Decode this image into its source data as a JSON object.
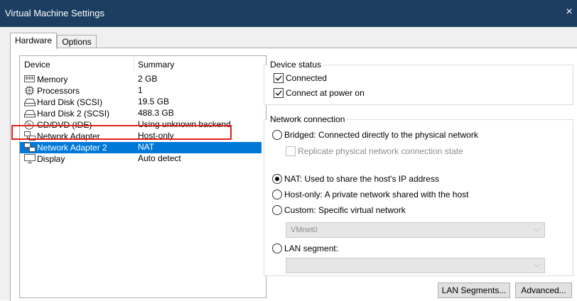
{
  "window": {
    "title": "Virtual Machine Settings",
    "close_glyph": "×"
  },
  "tabs": [
    {
      "label": "Hardware"
    },
    {
      "label": "Options"
    }
  ],
  "device_list": {
    "headers": {
      "device": "Device",
      "summary": "Summary"
    },
    "rows": [
      {
        "device": "Memory",
        "summary": "2 GB",
        "icon": "memory-icon"
      },
      {
        "device": "Processors",
        "summary": "1",
        "icon": "processor-icon"
      },
      {
        "device": "Hard Disk (SCSI)",
        "summary": "19.5 GB",
        "icon": "hard-disk-icon"
      },
      {
        "device": "Hard Disk 2 (SCSI)",
        "summary": "488.3 GB",
        "icon": "hard-disk-icon"
      },
      {
        "device": "CD/DVD (IDE)",
        "summary": "Using unknown backend",
        "icon": "cd-dvd-icon"
      },
      {
        "device": "Network Adapter",
        "summary": "Host-only",
        "icon": "network-adapter-icon"
      },
      {
        "device": "Network Adapter 2",
        "summary": "NAT",
        "icon": "network-adapter-icon",
        "selected": true
      },
      {
        "device": "Display",
        "summary": "Auto detect",
        "icon": "display-icon"
      }
    ]
  },
  "device_status": {
    "label": "Device status",
    "connected": {
      "label": "Connected",
      "checked": true
    },
    "connect_at_power_on": {
      "label": "Connect at power on",
      "checked": true
    }
  },
  "network_connection": {
    "label": "Network connection",
    "bridged": {
      "label": "Bridged: Connected directly to the physical network",
      "checked": false
    },
    "replicate": {
      "label": "Replicate physical network connection state",
      "checked": false,
      "disabled": true
    },
    "nat": {
      "label": "NAT: Used to share the host's IP address",
      "checked": true
    },
    "host_only": {
      "label": "Host-only: A private network shared with the host",
      "checked": false
    },
    "custom": {
      "label": "Custom: Specific virtual network",
      "checked": false
    },
    "custom_value": "VMnet0",
    "lan_segment": {
      "label": "LAN segment:",
      "checked": false
    },
    "lan_segment_value": ""
  },
  "buttons": {
    "lan_segments": "LAN Segments...",
    "advanced": "Advanced..."
  },
  "colors": {
    "title_bar": "#1c3f61",
    "selection": "#0078d7",
    "highlight_box": "#e0201e"
  }
}
